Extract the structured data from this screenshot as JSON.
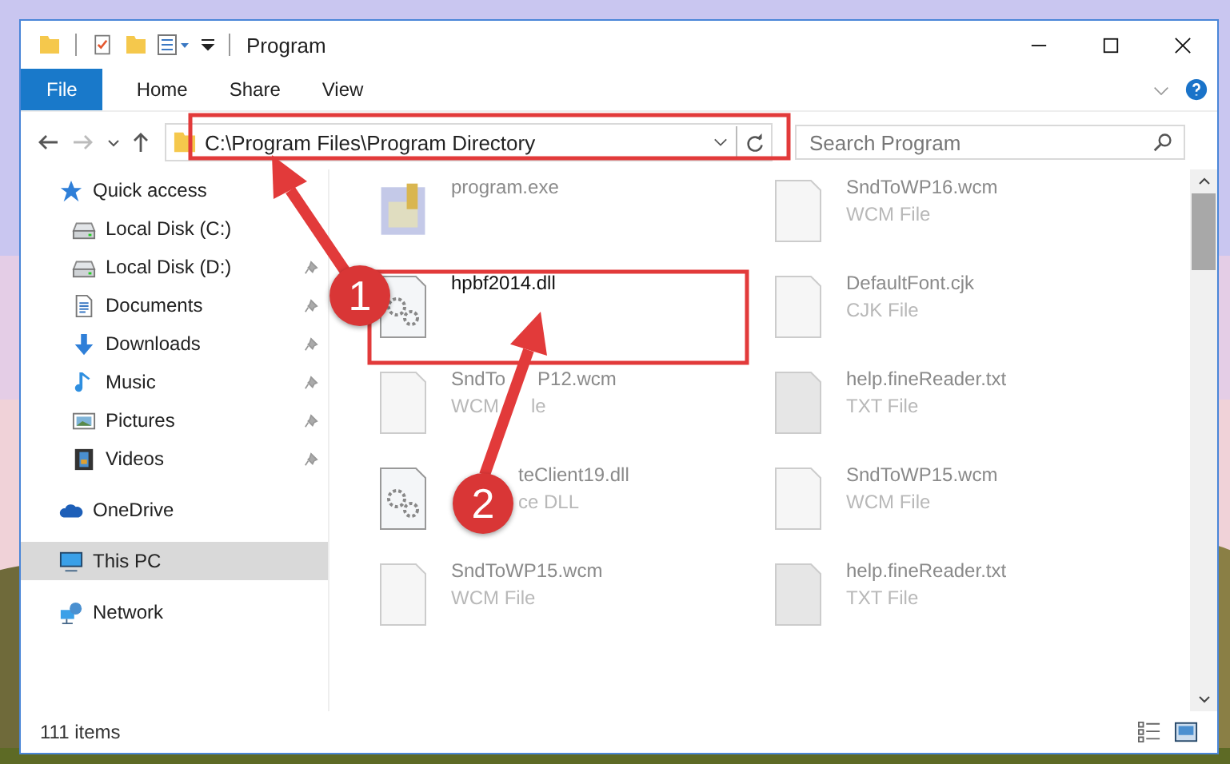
{
  "window": {
    "title": "Program"
  },
  "ribbon_tabs": [
    {
      "label": "File",
      "selected": true
    },
    {
      "label": "Home",
      "selected": false
    },
    {
      "label": "Share",
      "selected": false
    },
    {
      "label": "View",
      "selected": false
    }
  ],
  "address": {
    "path": "C:\\Program Files\\Program Directory"
  },
  "search": {
    "placeholder": "Search Program"
  },
  "sidebar": {
    "items": [
      {
        "label": "Quick access",
        "selected": false,
        "pinned": false,
        "children": [
          {
            "label": "Local Disk (C:)",
            "selected": false,
            "pinned": false
          },
          {
            "label": "Local Disk (D:)",
            "selected": false,
            "pinned": true
          },
          {
            "label": "Documents",
            "selected": false,
            "pinned": true
          },
          {
            "label": "Downloads",
            "selected": false,
            "pinned": true
          },
          {
            "label": "Music",
            "selected": false,
            "pinned": true
          },
          {
            "label": "Pictures",
            "selected": false,
            "pinned": true
          },
          {
            "label": "Videos",
            "selected": false,
            "pinned": true
          }
        ]
      },
      {
        "label": "OneDrive",
        "selected": false,
        "pinned": false
      },
      {
        "label": "This PC",
        "selected": true,
        "pinned": false
      },
      {
        "label": "Network",
        "selected": false,
        "pinned": false
      }
    ]
  },
  "files": [
    {
      "name": [
        "program.exe"
      ],
      "kind": "exe",
      "blurred": true
    },
    {
      "name": [
        "SndToWP16.wcm"
      ],
      "type": [
        "WCM File"
      ],
      "kind": "doc",
      "blurred": true
    },
    {
      "name": [
        "hpbf2014.dll"
      ],
      "kind": "dll",
      "blurred": false
    },
    {
      "name": [
        "DefaultFont.cjk"
      ],
      "type": [
        "CJK File"
      ],
      "kind": "doc",
      "blurred": true
    },
    {
      "name": [
        "SndTo",
        "P12.wcm"
      ],
      "type": [
        "WCM",
        "le"
      ],
      "kind": "doc",
      "blurred": true
    },
    {
      "name": [
        "help.fineReader.txt"
      ],
      "type": [
        "TXT File"
      ],
      "kind": "txt",
      "blurred": true
    },
    {
      "name": [
        "teClient19.dll"
      ],
      "type": [
        "ce DLL"
      ],
      "kind": "dll",
      "blurred": true,
      "covered": true
    },
    {
      "name": [
        "SndToWP15.wcm"
      ],
      "type": [
        "WCM File"
      ],
      "kind": "doc",
      "blurred": true
    },
    {
      "name": [
        "SndToWP15.wcm"
      ],
      "type": [
        "WCM File"
      ],
      "kind": "doc",
      "blurred": true
    },
    {
      "name": [
        "help.fineReader.txt"
      ],
      "type": [
        "TXT File"
      ],
      "kind": "txt",
      "blurred": true
    }
  ],
  "annotations": [
    {
      "number": "1"
    },
    {
      "number": "2"
    }
  ],
  "status_bar": {
    "count": "111 items"
  }
}
